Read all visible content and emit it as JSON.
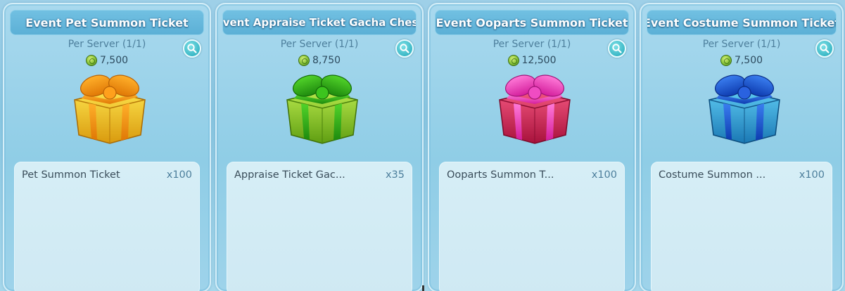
{
  "shop": {
    "cards": [
      {
        "title": "Event Pet Summon Ticket",
        "limit": "Per Server (1/1)",
        "price": "7,500",
        "gift_color": "orange",
        "item": {
          "name": "Pet Summon Ticket",
          "qty": "x100"
        }
      },
      {
        "title": "Event Appraise Ticket Gacha Chest",
        "limit": "Per Server (1/1)",
        "price": "8,750",
        "gift_color": "green",
        "item": {
          "name": "Appraise Ticket Gac...",
          "qty": "x35"
        }
      },
      {
        "title": "Event Ooparts Summon Ticket",
        "limit": "Per Server (1/1)",
        "price": "12,500",
        "gift_color": "pink",
        "item": {
          "name": "Ooparts Summon T...",
          "qty": "x100"
        }
      },
      {
        "title": "Event Costume Summon Ticket",
        "limit": "Per Server (1/1)",
        "price": "7,500",
        "gift_color": "blue",
        "item": {
          "name": "Costume Summon ...",
          "qty": "x100"
        }
      }
    ]
  },
  "icons": {
    "currency": "green-coin-icon",
    "zoom": "magnifier-icon"
  },
  "colors": {
    "orange_gift": "#f2a81c",
    "green_gift": "#7cc422",
    "pink_gift": "#e8346e",
    "blue_gift": "#2f8fd8",
    "title_bar": "#5cb0d6"
  }
}
